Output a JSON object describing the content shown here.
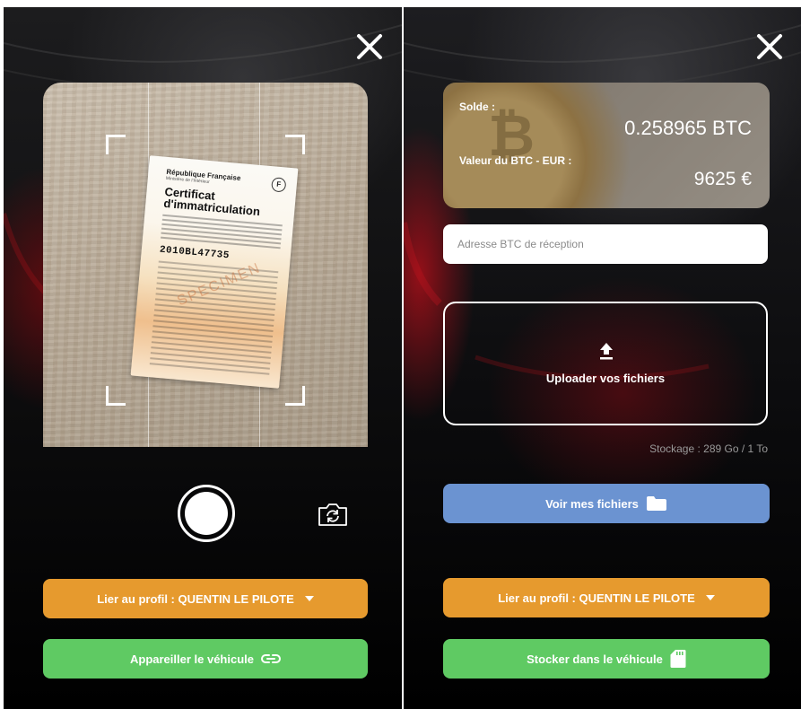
{
  "camera_screen": {
    "close_icon": "close-icon",
    "document": {
      "header": "République Française",
      "sub": "Ministère de l'Intérieur",
      "seal": "F",
      "title_line1": "Certificat",
      "title_line2": "d'immatriculation",
      "number": "2010BL47735",
      "watermark": "SPECIMEN"
    },
    "shutter_icon": "shutter-icon",
    "switch_camera_icon": "camera-switch-icon",
    "link_profile_button": "Lier au profil : QUENTIN LE PILOTE",
    "pair_vehicle_button": "Appareiller le véhicule",
    "pair_vehicle_icon": "link-icon"
  },
  "wallet_screen": {
    "close_icon": "close-icon",
    "card": {
      "solde_label": "Solde :",
      "btc_amount": "0.258965 BTC",
      "valeur_label": "Valeur du BTC - EUR :",
      "eur_value": "9625 €"
    },
    "btc_address_placeholder": "Adresse BTC de réception",
    "upload_label": "Uploader vos fichiers",
    "upload_icon": "upload-icon",
    "storage_text": "Stockage : 289 Go / 1 To",
    "view_files_button": "Voir mes fichiers",
    "folder_icon": "folder-icon",
    "link_profile_button": "Lier au profil : QUENTIN LE PILOTE",
    "store_vehicle_button": "Stocker dans le véhicule",
    "sd_card_icon": "sd-card-icon"
  },
  "colors": {
    "orange": "#e69a2e",
    "green": "#5fca63",
    "blue": "#6b93d1",
    "background": "#050505"
  }
}
